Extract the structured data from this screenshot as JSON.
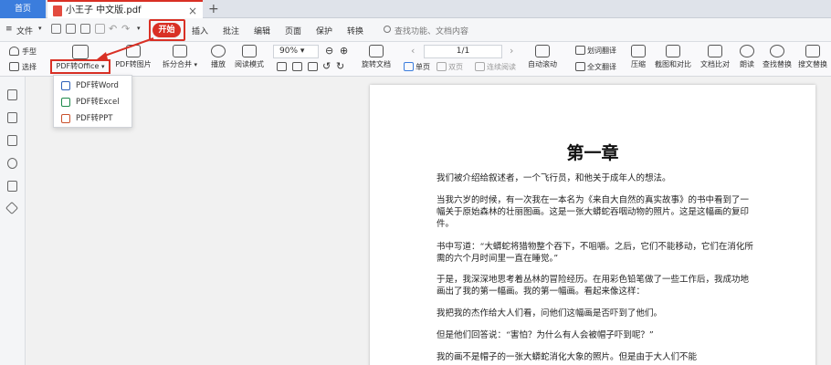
{
  "tabs": {
    "home": "首页",
    "document": "小王子 中文版.pdf"
  },
  "menu": {
    "file": "文件",
    "start": "开始",
    "insert": "插入",
    "annotate": "批注",
    "edit": "编辑",
    "page": "页面",
    "protect": "保护",
    "convert": "转换",
    "search_placeholder": "查找功能、文档内容"
  },
  "ribbon": {
    "hand": "手型",
    "select": "选择",
    "pdf_to_office": "PDF转Office",
    "pdf_to_image": "PDF转图片",
    "split_merge": "拆分合并",
    "play": "播放",
    "read_mode": "阅读模式",
    "zoom": "90%",
    "rotate": "旋转文档",
    "page_indicator": "1/1",
    "single_page": "单页",
    "double_page": "双页",
    "continuous": "连续阅读",
    "auto_scroll": "自动滚动",
    "translate_word": "划词翻译",
    "translate_full": "全文翻译",
    "compress": "压缩",
    "screenshot_compare": "截图和对比",
    "text_compare": "文档比对",
    "read_aloud": "朗读",
    "find_replace": "查找替换",
    "search_replace": "搜文替换"
  },
  "dropdown": {
    "items": [
      "PDF转Word",
      "PDF转Excel",
      "PDF转PPT"
    ]
  },
  "document": {
    "chapter_title": "第一章",
    "paragraphs": [
      "我们被介绍给叙述者，一个飞行员，和他关于成年人的想法。",
      "当我六岁的时候，有一次我在一本名为《来自大自然的真实故事》的书中看到了一幅关于原始森林的壮丽图画。这是一张大蟒蛇吞咽动物的照片。这是这幅画的复印件。",
      "书中写道：“大蟒蛇将猎物整个吞下，不咀嚼。之后，它们不能移动，它们在消化所需的六个月时间里一直在睡觉。”",
      "于是，我深深地思考着丛林的冒险经历。在用彩色铅笔做了一些工作后，我成功地画出了我的第一幅画。我的第一幅画。看起来像这样：",
      "我把我的杰作给大人们看，问他们这幅画是否吓到了他们。",
      "但是他们回答说：“害怕？为什么有人会被帽子吓到呢？”",
      "我的画不是帽子的一张大蟒蛇消化大象的照片。但是由于大人们不能"
    ]
  },
  "colors": {
    "accent_red": "#d93025",
    "home_blue": "#3b7ddd"
  }
}
